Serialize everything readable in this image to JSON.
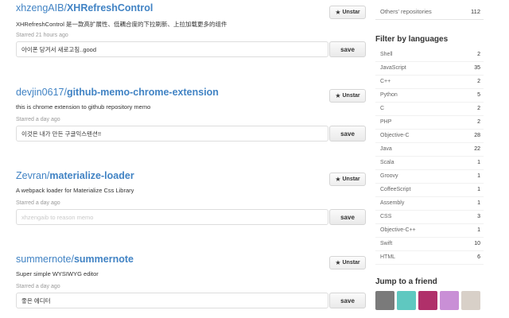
{
  "repos": [
    {
      "owner": "xhzengAIB",
      "name": "XHRefreshControl",
      "description": "XHRefreshControl 是一款高扩展性、低耦合度的下拉刷新、上拉加载更多的组件",
      "starred": "Starred 21 hours ago",
      "note_value": "아이폰 당겨서 새로고침..good",
      "note_placeholder": "",
      "unstar_label": "Unstar",
      "save_label": "save"
    },
    {
      "owner": "devjin0617",
      "name": "github-memo-chrome-extension",
      "description": "this is chrome extension to github repository memo",
      "starred": "Starred a day ago",
      "note_value": "이것은 내가 만든 구글익스텐션!!",
      "note_placeholder": "",
      "unstar_label": "Unstar",
      "save_label": "save"
    },
    {
      "owner": "Zevran",
      "name": "materialize-loader",
      "description": "A webpack loader for Materialize Css Library",
      "starred": "Starred a day ago",
      "note_value": "",
      "note_placeholder": "xhzengaib to reason memo",
      "unstar_label": "Unstar",
      "save_label": "save"
    },
    {
      "owner": "summernote",
      "name": "summernote",
      "description": "Super simple WYSIWYG editor",
      "starred": "Starred a day ago",
      "note_value": "좋은 에디터",
      "note_placeholder": "",
      "unstar_label": "Unstar",
      "save_label": "save"
    }
  ],
  "sidebar": {
    "other_label": "Others' repositories",
    "other_count": "112",
    "filter_heading": "Filter by languages",
    "languages": [
      {
        "name": "Shell",
        "count": "2"
      },
      {
        "name": "JavaScript",
        "count": "35"
      },
      {
        "name": "C++",
        "count": "2"
      },
      {
        "name": "Python",
        "count": "5"
      },
      {
        "name": "C",
        "count": "2"
      },
      {
        "name": "PHP",
        "count": "2"
      },
      {
        "name": "Objective-C",
        "count": "28"
      },
      {
        "name": "Java",
        "count": "22"
      },
      {
        "name": "Scala",
        "count": "1"
      },
      {
        "name": "Groovy",
        "count": "1"
      },
      {
        "name": "CoffeeScript",
        "count": "1"
      },
      {
        "name": "Assembly",
        "count": "1"
      },
      {
        "name": "CSS",
        "count": "3"
      },
      {
        "name": "Objective-C++",
        "count": "1"
      },
      {
        "name": "Swift",
        "count": "10"
      },
      {
        "name": "HTML",
        "count": "6"
      }
    ],
    "friends_heading": "Jump to a friend",
    "friend_avatar_colors": [
      "#7a7a7a",
      "#5fc8c0",
      "#b0306a",
      "#c98fd6",
      "#d8d0c8"
    ]
  },
  "colors": {
    "link": "#4183c4"
  }
}
